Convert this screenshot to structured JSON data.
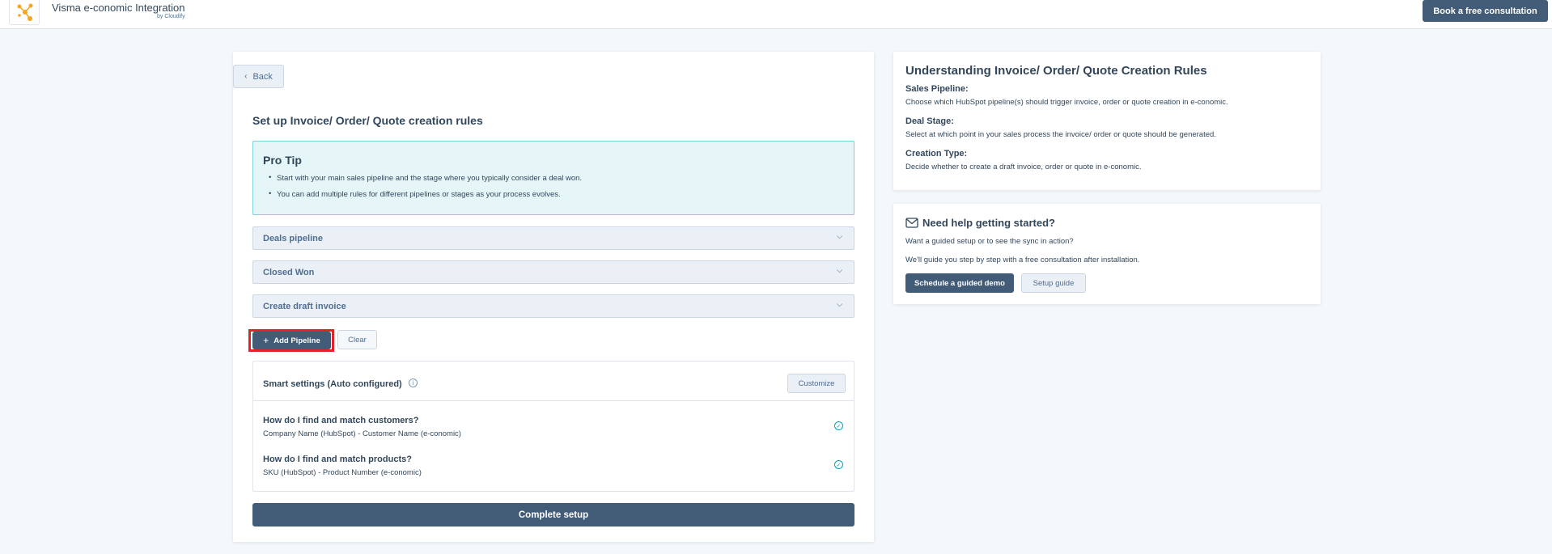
{
  "header": {
    "app_title": "Visma e-conomic Integration",
    "app_subtitle": "by Cloudify",
    "book_button": "Book a free consultation",
    "logo_icon": "cloudify-logo-icon",
    "accent": "#f5a623"
  },
  "main": {
    "back_label": "Back",
    "section_title": "Set up Invoice/ Order/ Quote creation rules",
    "protip": {
      "title": "Pro Tip",
      "tips": [
        "Start with your main sales pipeline and the stage where you typically consider a deal won.",
        "You can add multiple rules for different pipelines or stages as your process evolves."
      ]
    },
    "dropdowns": [
      {
        "value": "Deals pipeline"
      },
      {
        "value": "Closed Won"
      },
      {
        "value": "Create draft invoice"
      }
    ],
    "add_pipeline_label": "Add Pipeline",
    "clear_label": "Clear",
    "smart": {
      "title": "Smart settings (Auto configured)",
      "customize_label": "Customize",
      "matches": [
        {
          "question": "How do I find and match customers?",
          "answer": "Company Name (HubSpot)  -  Customer Name (e-conomic)"
        },
        {
          "question": "How do I find and match products?",
          "answer": "SKU (HubSpot)  -  Product Number (e-conomic)"
        }
      ]
    },
    "complete_label": "Complete setup"
  },
  "info": {
    "title": "Understanding Invoice/ Order/ Quote Creation Rules",
    "items": [
      {
        "label": "Sales Pipeline:",
        "text": "Choose which HubSpot pipeline(s) should trigger invoice, order or quote creation in e-conomic."
      },
      {
        "label": "Deal Stage:",
        "text": "Select at which point in your sales process the invoice/ order or quote should be generated."
      },
      {
        "label": "Creation Type:",
        "text": "Decide whether to create a draft invoice, order or quote in e-conomic."
      }
    ]
  },
  "help": {
    "title": "Need help getting started?",
    "line1": "Want a guided setup or to see the sync in action?",
    "line2": "We'll guide you step by step with a free consultation after installation.",
    "demo_label": "Schedule a guided demo",
    "guide_label": "Setup guide"
  },
  "colors": {
    "primary": "#425b76",
    "highlight": "#e32127",
    "protip_bg": "#e5f5f8",
    "protip_border": "#7fd1de"
  }
}
